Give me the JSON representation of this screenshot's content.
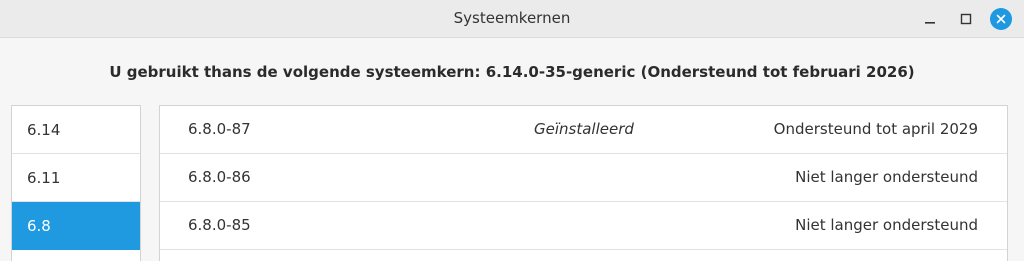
{
  "window": {
    "title": "Systeemkernen"
  },
  "heading": "U gebruikt thans de volgende systeemkern: 6.14.0-35-generic (Ondersteund tot februari 2026)",
  "sidebar": {
    "items": [
      {
        "label": "6.14",
        "selected": false
      },
      {
        "label": "6.11",
        "selected": false
      },
      {
        "label": "6.8",
        "selected": true
      }
    ]
  },
  "kernels": {
    "rows": [
      {
        "version": "6.8.0-87",
        "installed": "Geïnstalleerd",
        "support": "Ondersteund tot april 2029"
      },
      {
        "version": "6.8.0-86",
        "installed": "",
        "support": "Niet langer ondersteund"
      },
      {
        "version": "6.8.0-85",
        "installed": "",
        "support": "Niet langer ondersteund"
      }
    ]
  },
  "colors": {
    "accent": "#1f9ae0"
  },
  "icons": {
    "minimize": "minimize-icon",
    "maximize": "maximize-icon",
    "close": "close-icon"
  }
}
